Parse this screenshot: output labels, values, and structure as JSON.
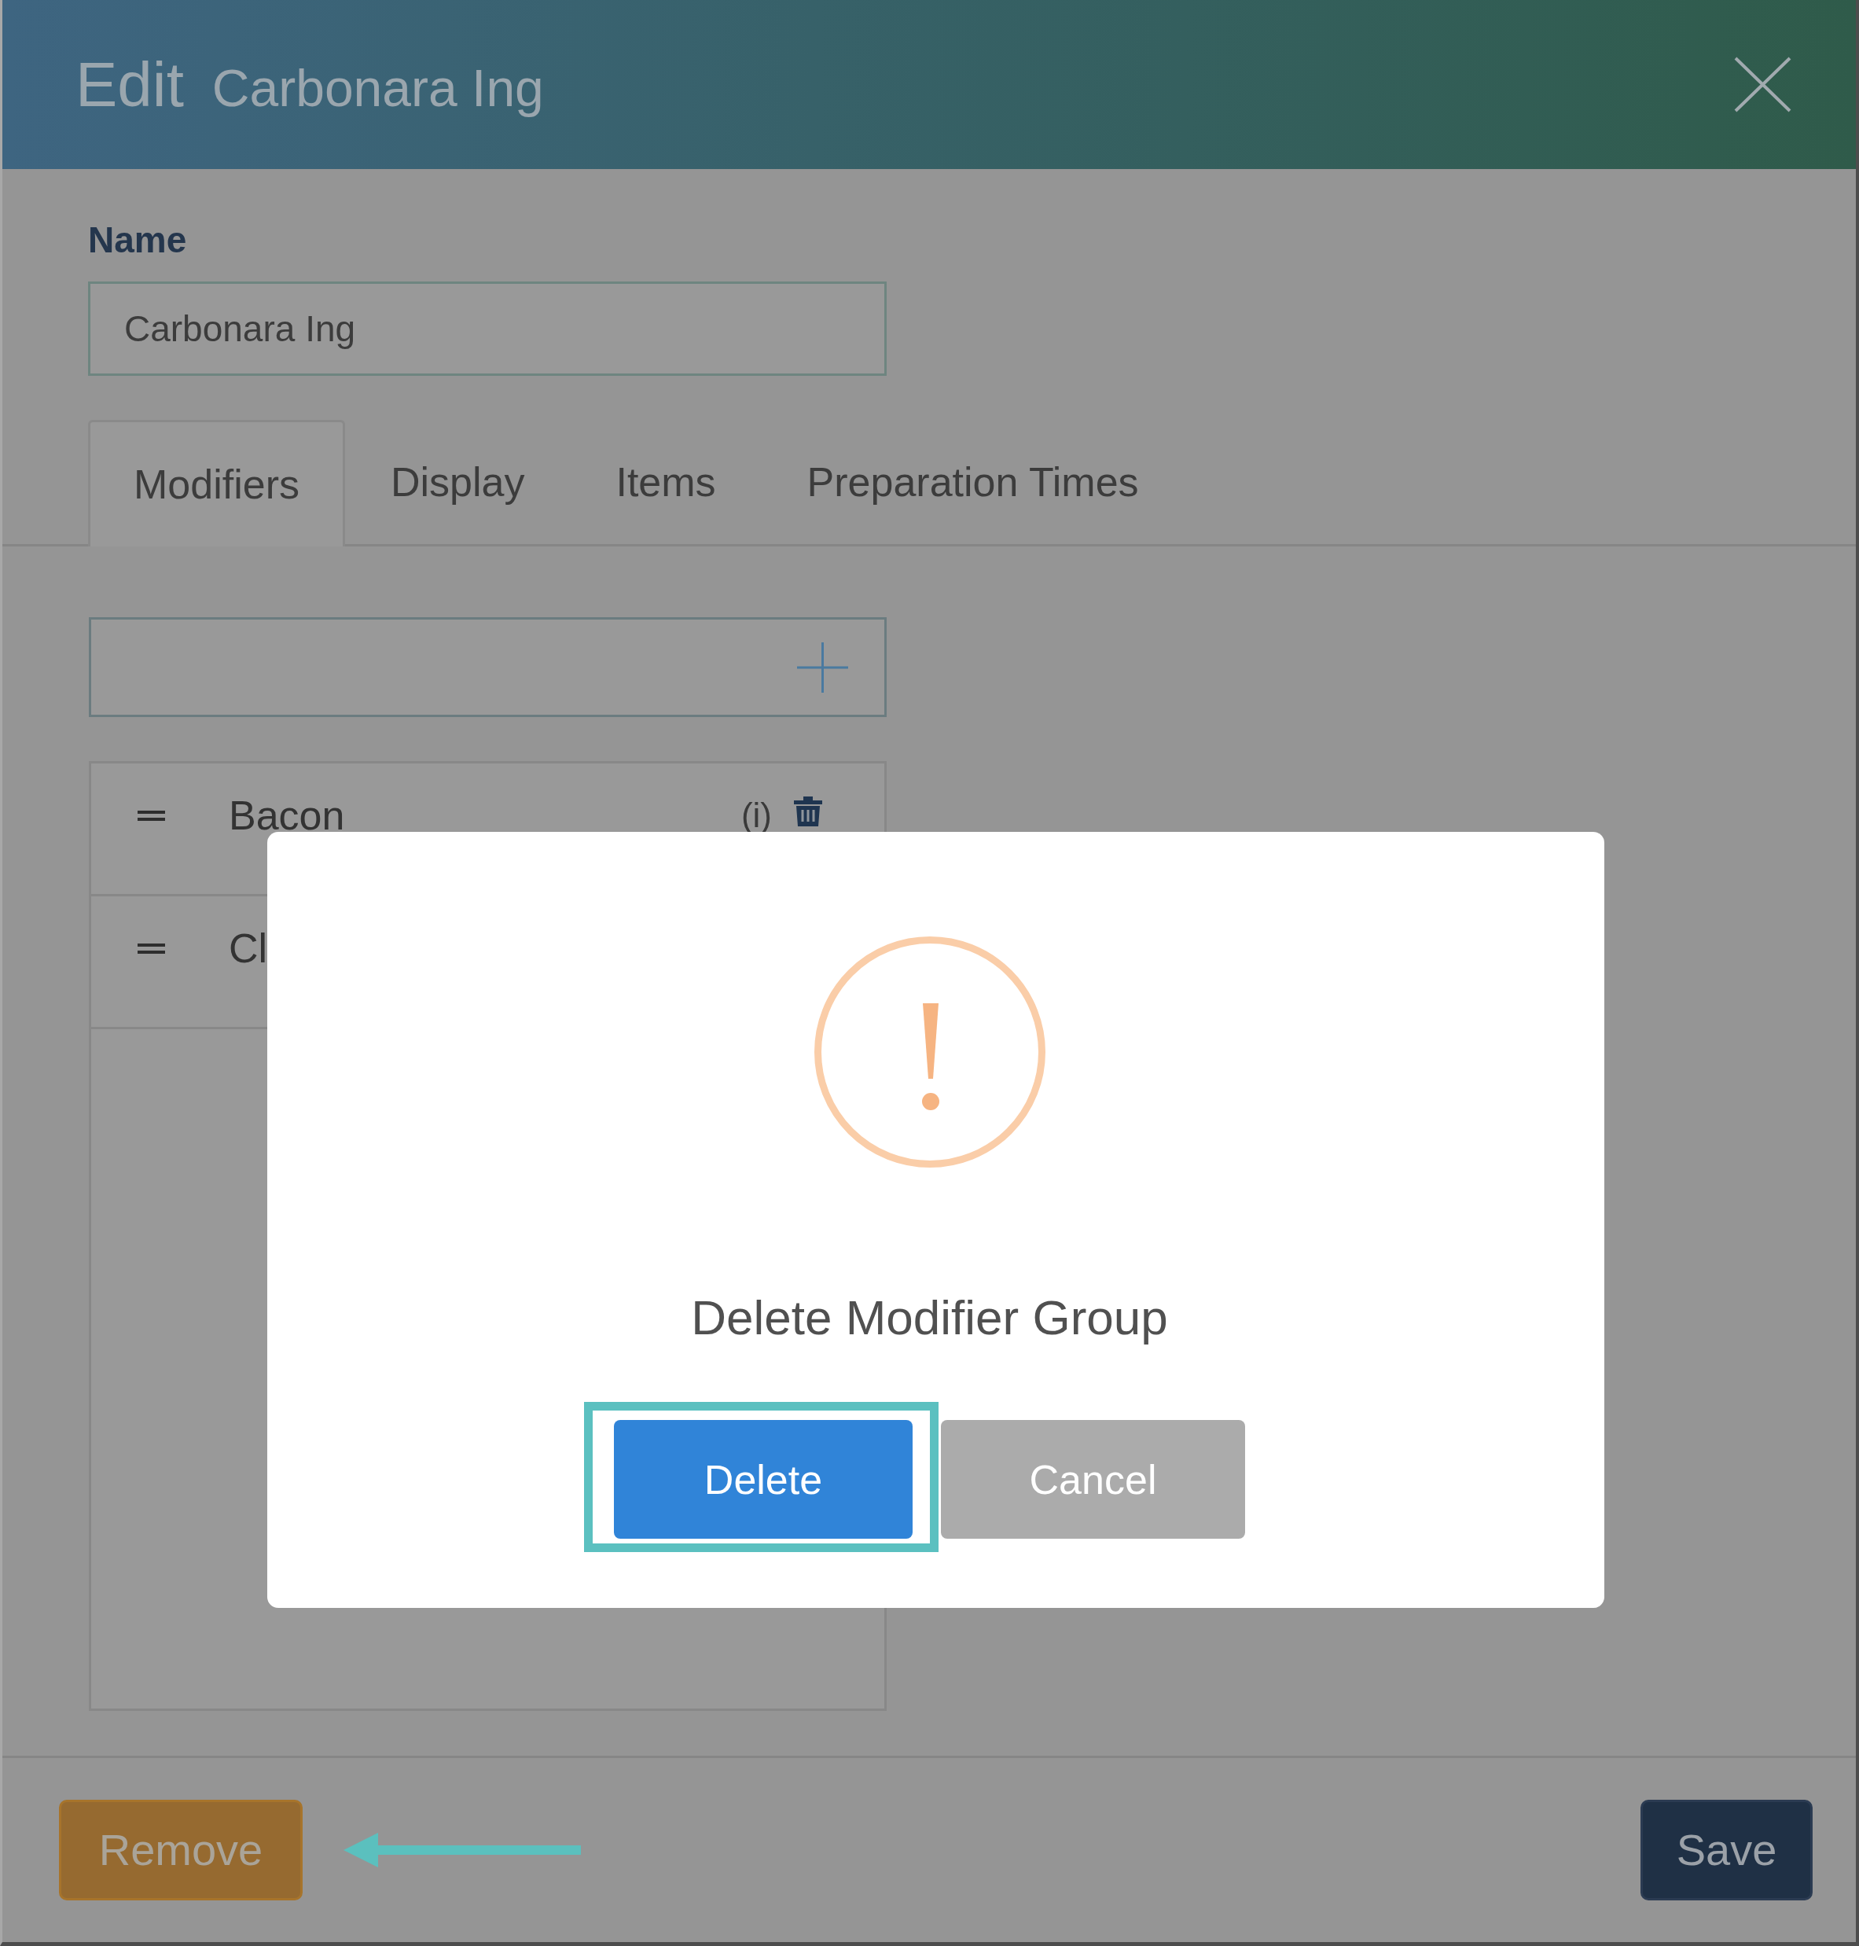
{
  "header": {
    "title": "Edit",
    "subtitle": "Carbonara Ing"
  },
  "name_field": {
    "label": "Name",
    "value": "Carbonara Ing"
  },
  "tabs": [
    {
      "label": "Modifiers",
      "selected": true
    },
    {
      "label": "Display",
      "selected": false
    },
    {
      "label": "Items",
      "selected": false
    },
    {
      "label": "Preparation Times",
      "selected": false
    }
  ],
  "modifier_groups": [
    {
      "name": "Bacon",
      "info": "(i)"
    },
    {
      "name": "Cl"
    }
  ],
  "footer": {
    "buttons": [
      {
        "kind": "remove",
        "label": "Remove",
        "arrow_pointer": true
      },
      {
        "kind": "save",
        "label": "Save",
        "arrow_pointer": false
      }
    ]
  },
  "dialog": {
    "title": "Delete Modifier Group",
    "buttons": [
      {
        "kind": "primary",
        "label": "Delete",
        "highlighted": true
      },
      {
        "kind": "secondary",
        "label": "Cancel",
        "highlighted": false
      }
    ]
  }
}
